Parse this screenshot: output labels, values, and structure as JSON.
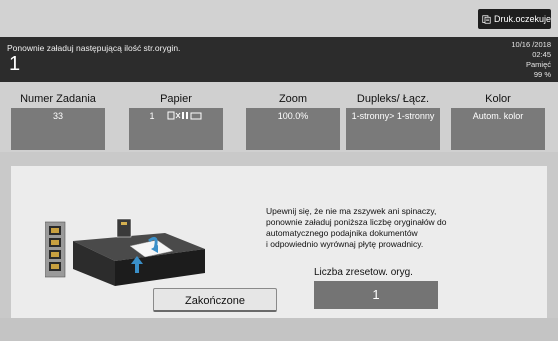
{
  "job_button": {
    "label": "Druk.oczekuje",
    "icon": "print-queue-icon"
  },
  "message": {
    "text": "Ponownie załaduj następującą ilość str.orygin.",
    "count": "1",
    "date": "10/16 /2018",
    "time": "02:45",
    "memory_label": "Pamięć",
    "memory_value": "99 %"
  },
  "columns": [
    {
      "header": "Numer Zadania",
      "value": "33"
    },
    {
      "header": "Papier",
      "value": "1"
    },
    {
      "header": "Zoom",
      "value": "100.0%"
    },
    {
      "header": "Dupleks/ Łącz.",
      "value": "1-stronny> 1-stronny"
    },
    {
      "header": "Kolor",
      "value": "Autom. kolor"
    }
  ],
  "instructions": {
    "line1": "Upewnij się, że nie ma zszywek ani spinaczy,",
    "line2": "ponownie załaduj poniższa liczbę oryginałów do",
    "line3": "automatycznego podajnika dokumentów",
    "line4": "i odpowiednio wyrównaj płytę prowadnicy."
  },
  "reset_count": {
    "label": "Liczba zresetow. oryg.",
    "value": "1"
  },
  "done_button": {
    "label": "Zakończone"
  },
  "colors": {
    "message_bar": "#2c2c2c",
    "value_box": "#7a7a7a",
    "panel": "#ececec"
  }
}
